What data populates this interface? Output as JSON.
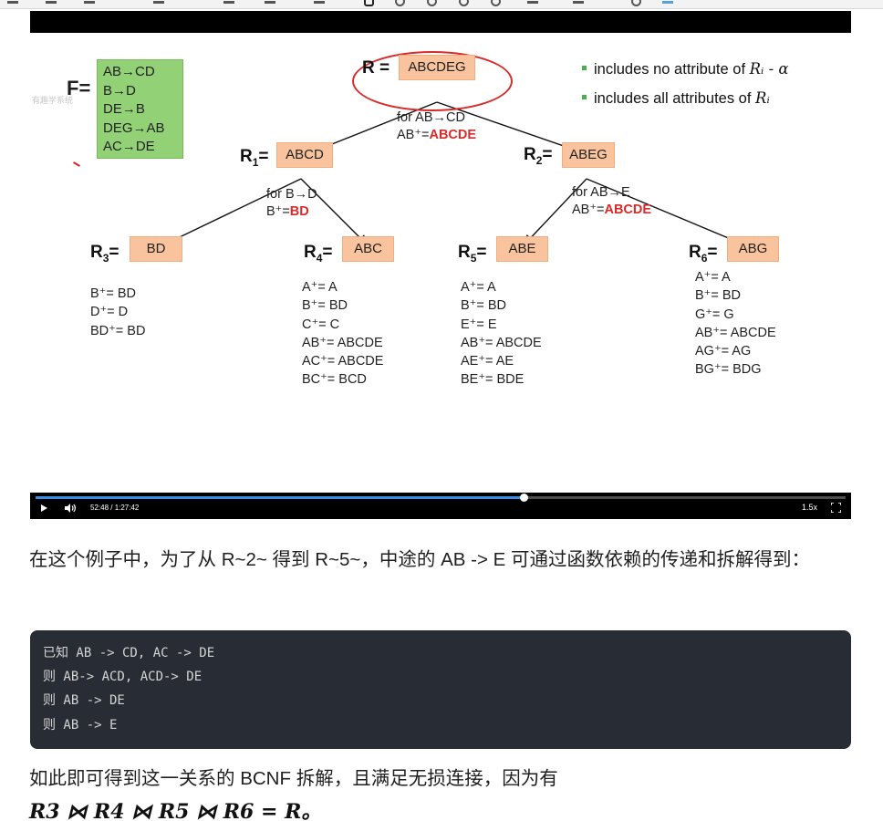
{
  "slide": {
    "f_label": "F=",
    "fds": [
      "AB→CD",
      "B→D",
      "DE→B",
      "DEG→AB",
      "AC→DE"
    ],
    "watermark": "有趣学系统",
    "legend": {
      "line1_prefix": "includes no attribute of ",
      "line1_math": "Rᵢ - α",
      "line2_prefix": "includes all attributes of ",
      "line2_math": "Rᵢ"
    },
    "root": {
      "label": "R =",
      "value": "ABCDEG"
    },
    "r1": {
      "label": "R",
      "sub": "1",
      "eq": "=",
      "value": "ABCD"
    },
    "r2": {
      "label": "R",
      "sub": "2",
      "eq": "=",
      "value": "ABEG"
    },
    "r3": {
      "label": "R",
      "sub": "3",
      "eq": "=",
      "value": "BD"
    },
    "r4": {
      "label": "R",
      "sub": "4",
      "eq": "=",
      "value": "ABC"
    },
    "r5": {
      "label": "R",
      "sub": "5",
      "eq": "=",
      "value": "ABE"
    },
    "r6": {
      "label": "R",
      "sub": "6",
      "eq": "=",
      "value": "ABG"
    },
    "note_root": {
      "line1": "for AB→CD",
      "line2_prefix": "AB⁺=",
      "line2_red": "ABCDE"
    },
    "note_r1": {
      "line1": "for B→D",
      "line2_prefix": "B⁺=",
      "line2_red": "BD"
    },
    "note_r2": {
      "line1": "for AB→E",
      "line2_prefix": "AB⁺=",
      "line2_red": "ABCDE"
    },
    "closures_r3": [
      "B⁺= BD",
      "D⁺= D",
      "BD⁺= BD"
    ],
    "closures_r4": [
      "A⁺= A",
      "B⁺= BD",
      "C⁺= C",
      "AB⁺= ABCDE",
      "AC⁺= ABCDE",
      "BC⁺= BCD"
    ],
    "closures_r5": [
      "A⁺= A",
      "B⁺= BD",
      "E⁺= E",
      "AB⁺= ABCDE",
      "AE⁺= AE",
      "BE⁺= BDE"
    ],
    "closures_r6": [
      "A⁺= A",
      "B⁺= BD",
      "G⁺= G",
      "AB⁺= ABCDE",
      "AG⁺= AG",
      "BG⁺= BDG"
    ]
  },
  "player": {
    "time": "52:48 / 1:27:42",
    "speed": "1.5x",
    "progress": 0.602
  },
  "article": {
    "para1": "在这个例子中，为了从 R~2~ 得到 R~5~，中途的 AB -> E 可通过函数依赖的传递和拆解得到：",
    "code_lines": [
      "已知 AB -> CD, AC -> DE",
      "则 AB-> ACD, ACD-> DE",
      "则 AB -> DE",
      "则 AB -> E"
    ],
    "para2": "如此即可得到这一关系的 BCNF 拆解，且满足无损连接，因为有",
    "math": "R3 ⋈ R4 ⋈ R5 ⋈ R6 = R。"
  }
}
